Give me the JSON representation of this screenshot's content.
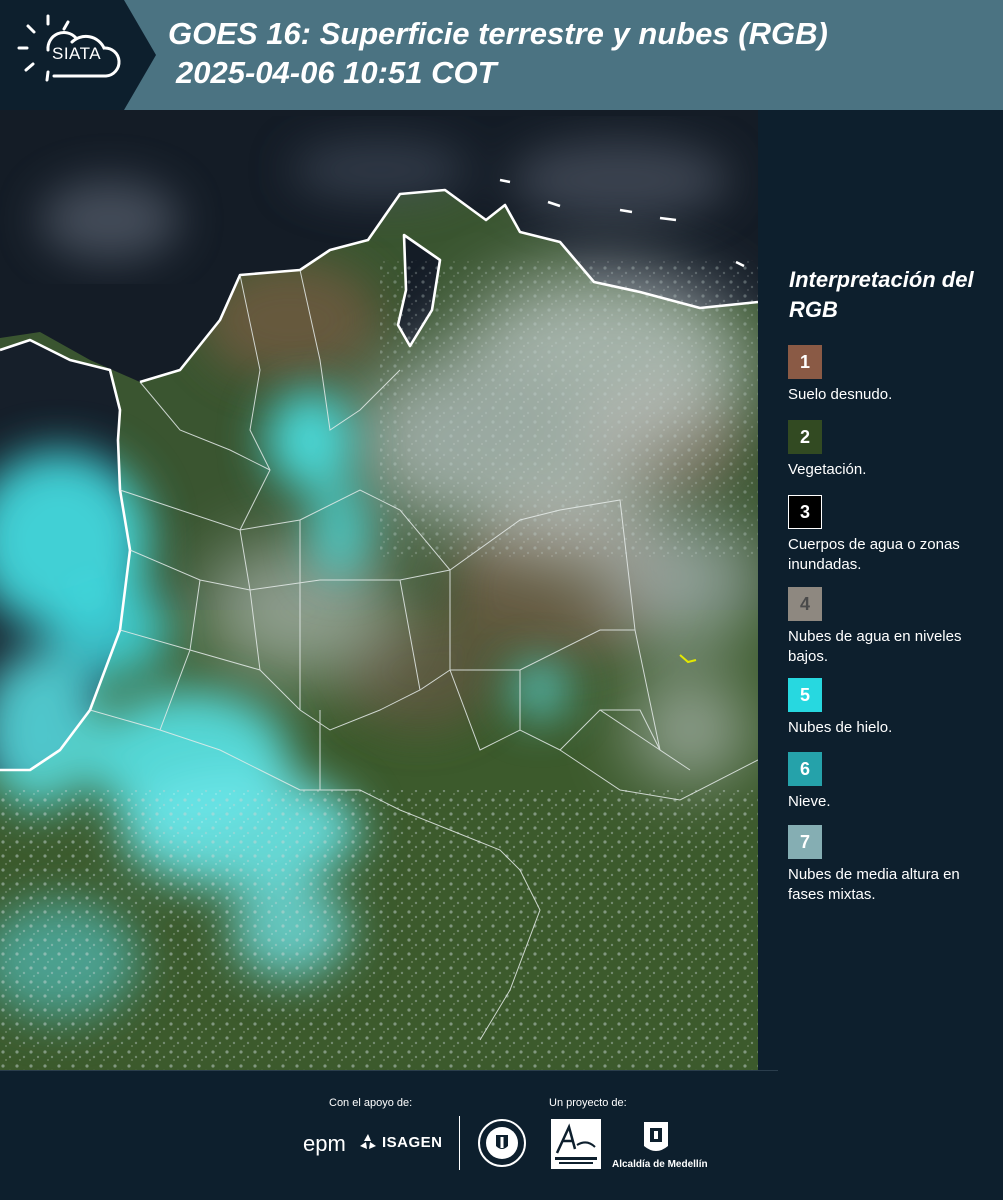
{
  "header": {
    "logo_text": "SIATA",
    "title_line1": "GOES 16: Superficie terrestre y nubes (RGB)",
    "title_line2": "2025-04-06 10:51 COT"
  },
  "legend": {
    "title": "Interpretación del RGB",
    "items": [
      {
        "number": "1",
        "label": "Suelo desnudo.",
        "color": "#8a5a45"
      },
      {
        "number": "2",
        "label": "Vegetación.",
        "color": "#324a22"
      },
      {
        "number": "3",
        "label": "Cuerpos de agua o zonas inundadas.",
        "color": "#000000"
      },
      {
        "number": "4",
        "label": "Nubes de agua en niveles bajos.",
        "color": "#8e8880"
      },
      {
        "number": "5",
        "label": "Nubes de hielo.",
        "color": "#27d8e0"
      },
      {
        "number": "6",
        "label": "Nieve.",
        "color": "#25a2aa"
      },
      {
        "number": "7",
        "label": "Nubes de media altura en fases mixtas.",
        "color": "#85aeb3"
      }
    ]
  },
  "footer": {
    "support_label": "Con el apoyo de:",
    "project_label": "Un proyecto de:",
    "sponsors": [
      "epm",
      "ISAGEN"
    ],
    "partners": [
      "Área Metropolitana Valle de Aburrá",
      "Alcaldía de Medellín"
    ],
    "alcaldia_text": "Alcaldía de Medellín"
  },
  "colors": {
    "header_bg": "#4b7382",
    "dark_bg": "#0d1f2d",
    "ocean": "#141c26",
    "vegetation": "#37502c",
    "bare_soil": "#6a5a3e",
    "ice_cloud": "#3fe0e6",
    "low_cloud": "#b9c5c6"
  }
}
